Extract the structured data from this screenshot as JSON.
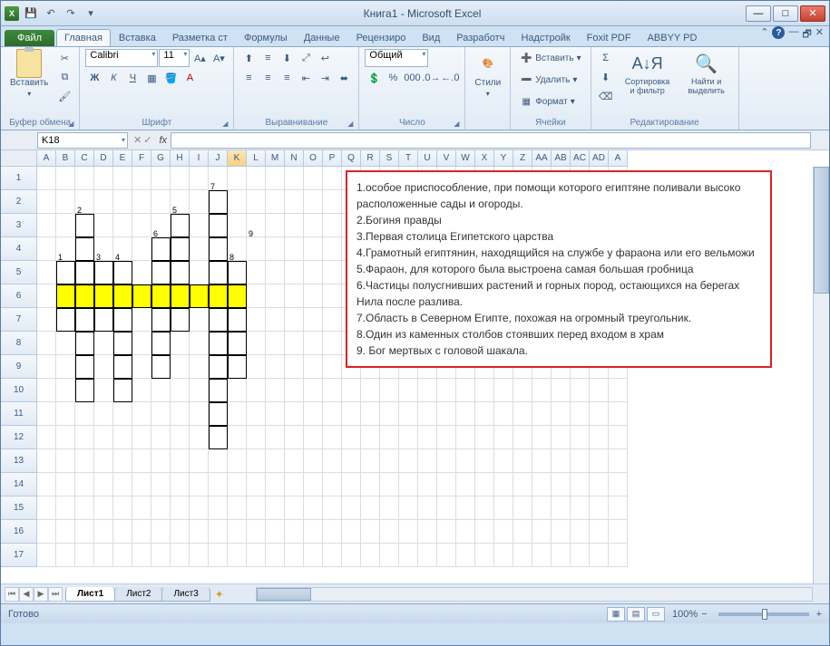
{
  "window": {
    "title": "Книга1 - Microsoft Excel"
  },
  "qat": {
    "save": "💾",
    "undo": "↶",
    "redo": "↷"
  },
  "tabs": {
    "file": "Файл",
    "items": [
      "Главная",
      "Вставка",
      "Разметка ст",
      "Формулы",
      "Данные",
      "Рецензиро",
      "Вид",
      "Разработч",
      "Надстройк",
      "Foxit PDF",
      "ABBYY PD"
    ],
    "active_index": 0
  },
  "ribbon": {
    "clipboard": {
      "paste": "Вставить",
      "label": "Буфер обмена"
    },
    "font": {
      "name": "Calibri",
      "size": "11",
      "label": "Шрифт"
    },
    "align": {
      "label": "Выравнивание"
    },
    "number": {
      "format": "Общий",
      "label": "Число"
    },
    "styles": {
      "btn": "Стили",
      "label": ""
    },
    "cells": {
      "insert": "Вставить",
      "delete": "Удалить",
      "format": "Формат",
      "label": "Ячейки"
    },
    "editing": {
      "sort": "Сортировка и фильтр",
      "find": "Найти и выделить",
      "label": "Редактирование"
    }
  },
  "formula_bar": {
    "name_box": "K18",
    "fx": "fx",
    "value": ""
  },
  "columns": [
    "A",
    "B",
    "C",
    "D",
    "E",
    "F",
    "G",
    "H",
    "I",
    "J",
    "K",
    "L",
    "M",
    "N",
    "O",
    "P",
    "Q",
    "R",
    "S",
    "T",
    "U",
    "V",
    "W",
    "X",
    "Y",
    "Z",
    "AA",
    "AB",
    "AC",
    "AD",
    "A"
  ],
  "row_count": 17,
  "selected_col_index": 10,
  "crossword": {
    "yellow_row": 6,
    "yellow_cols": [
      "B",
      "C",
      "D",
      "E",
      "F",
      "G",
      "H",
      "I",
      "J",
      "K"
    ],
    "bordered": [
      {
        "c": "J",
        "r": 2
      },
      {
        "c": "C",
        "r": 3
      },
      {
        "c": "H",
        "r": 3
      },
      {
        "c": "J",
        "r": 3
      },
      {
        "c": "C",
        "r": 4
      },
      {
        "c": "G",
        "r": 4
      },
      {
        "c": "H",
        "r": 4
      },
      {
        "c": "J",
        "r": 4
      },
      {
        "c": "B",
        "r": 5
      },
      {
        "c": "C",
        "r": 5
      },
      {
        "c": "D",
        "r": 5
      },
      {
        "c": "E",
        "r": 5
      },
      {
        "c": "G",
        "r": 5
      },
      {
        "c": "H",
        "r": 5
      },
      {
        "c": "J",
        "r": 5
      },
      {
        "c": "K",
        "r": 5
      },
      {
        "c": "B",
        "r": 6
      },
      {
        "c": "C",
        "r": 6
      },
      {
        "c": "D",
        "r": 6
      },
      {
        "c": "E",
        "r": 6
      },
      {
        "c": "F",
        "r": 6
      },
      {
        "c": "G",
        "r": 6
      },
      {
        "c": "H",
        "r": 6
      },
      {
        "c": "I",
        "r": 6
      },
      {
        "c": "J",
        "r": 6
      },
      {
        "c": "K",
        "r": 6
      },
      {
        "c": "B",
        "r": 7
      },
      {
        "c": "C",
        "r": 7
      },
      {
        "c": "D",
        "r": 7
      },
      {
        "c": "E",
        "r": 7
      },
      {
        "c": "G",
        "r": 7
      },
      {
        "c": "H",
        "r": 7
      },
      {
        "c": "J",
        "r": 7
      },
      {
        "c": "K",
        "r": 7
      },
      {
        "c": "C",
        "r": 8
      },
      {
        "c": "E",
        "r": 8
      },
      {
        "c": "G",
        "r": 8
      },
      {
        "c": "J",
        "r": 8
      },
      {
        "c": "K",
        "r": 8
      },
      {
        "c": "C",
        "r": 9
      },
      {
        "c": "E",
        "r": 9
      },
      {
        "c": "G",
        "r": 9
      },
      {
        "c": "J",
        "r": 9
      },
      {
        "c": "K",
        "r": 9
      },
      {
        "c": "C",
        "r": 10
      },
      {
        "c": "E",
        "r": 10
      },
      {
        "c": "J",
        "r": 10
      },
      {
        "c": "J",
        "r": 11
      },
      {
        "c": "J",
        "r": 12
      }
    ],
    "numbers": [
      {
        "c": "J",
        "r": 2,
        "n": "7"
      },
      {
        "c": "C",
        "r": 3,
        "n": "2"
      },
      {
        "c": "H",
        "r": 3,
        "n": "5"
      },
      {
        "c": "G",
        "r": 4,
        "n": "6"
      },
      {
        "c": "B",
        "r": 5,
        "n": "1"
      },
      {
        "c": "D",
        "r": 5,
        "n": "3"
      },
      {
        "c": "E",
        "r": 5,
        "n": "4"
      },
      {
        "c": "K",
        "r": 5,
        "n": "8"
      },
      {
        "c": "L",
        "r": 4,
        "n": "9"
      }
    ]
  },
  "clues": [
    "1.особое приспособление, при помощи которого египтяне поливали высоко расположенные сады и огороды.",
    "2.Богиня правды",
    "3.Первая столица Египетского царства",
    "4.Грамотный египтянин, находящийся на службе у фараона или его вельможи",
    "5.Фараон, для которого была выстроена самая большая гробница",
    "6.Частицы полусгнивших растений и горных пород, остающихся на берегах Нила после разлива.",
    "7.Область в Северном Египте, похожая на огромный треугольник.",
    "8.Один из каменных столбов стоявших перед входом в храм",
    "9. Бог мертвых с головой шакала."
  ],
  "sheets": {
    "items": [
      "Лист1",
      "Лист2",
      "Лист3"
    ],
    "active": 0
  },
  "status": {
    "ready": "Готово",
    "zoom": "100%",
    "minus": "−",
    "plus": "+"
  }
}
